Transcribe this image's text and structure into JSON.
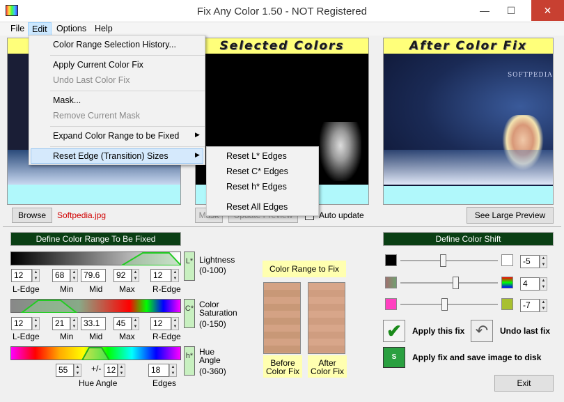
{
  "window": {
    "title": "Fix Any Color 1.50 - NOT Registered",
    "minimize": "—",
    "maximize": "☐",
    "close": "✕"
  },
  "menubar": {
    "file": "File",
    "edit": "Edit",
    "options": "Options",
    "help": "Help"
  },
  "edit_menu": {
    "history": "Color Range Selection History...",
    "apply": "Apply Current Color Fix",
    "undo": "Undo Last Color Fix",
    "mask": "Mask...",
    "remove_mask": "Remove Current Mask",
    "expand": "Expand Color Range to be Fixed",
    "reset_edge": "Reset Edge (Transition) Sizes"
  },
  "reset_submenu": {
    "l": "Reset L* Edges",
    "c": "Reset C* Edges",
    "h": "Reset h* Edges",
    "all": "Reset All Edges"
  },
  "previews": {
    "selected_title": "Selected Colors",
    "after_title": "After Color Fix",
    "watermark": "SOFTPEDIA"
  },
  "toolbar": {
    "browse": "Browse",
    "filename": "Softpedia.jpg",
    "mask": "Mask",
    "update": "Update Preview",
    "auto_update": "Auto update",
    "large_preview": "See Large Preview"
  },
  "range_panel": {
    "header": "Define Color Range To Be Fixed",
    "lightness": {
      "btn": "L*",
      "name": "Lightness",
      "range": "(0-100)",
      "l_edge": "12",
      "min": "68",
      "mid": "79.6",
      "max": "92",
      "r_edge": "12"
    },
    "saturation": {
      "btn": "C*",
      "name": "Color\nSaturation",
      "name1": "Color",
      "name2": "Saturation",
      "range": "(0-150)",
      "l_edge": "12",
      "min": "21",
      "mid": "33.1",
      "max": "45",
      "r_edge": "12"
    },
    "hue": {
      "btn": "h*",
      "name1": "Hue",
      "name2": "Angle",
      "range": "(0-360)",
      "angle": "55",
      "pm": "+/-",
      "delta": "12",
      "edges": "18"
    },
    "labels": {
      "l_edge": "L-Edge",
      "min": "Min",
      "mid": "Mid",
      "max": "Max",
      "r_edge": "R-Edge",
      "hue_angle": "Hue Angle",
      "edges": "Edges"
    }
  },
  "color_range": {
    "title": "Color Range to Fix",
    "before": "Before\nColor Fix",
    "before1": "Before",
    "before2": "Color Fix",
    "after1": "After",
    "after2": "Color Fix"
  },
  "shift_panel": {
    "header": "Define Color Shift",
    "v1": "-5",
    "v2": "4",
    "v3": "-7"
  },
  "actions": {
    "apply": "Apply this fix",
    "undo": "Undo last fix",
    "save": "Apply fix and save image to disk",
    "exit": "Exit"
  },
  "colors": {
    "dark_green": "#0a3f14",
    "yellow": "#ffff7a",
    "cyan": "#b0f8fb",
    "error_red": "#d00000"
  }
}
